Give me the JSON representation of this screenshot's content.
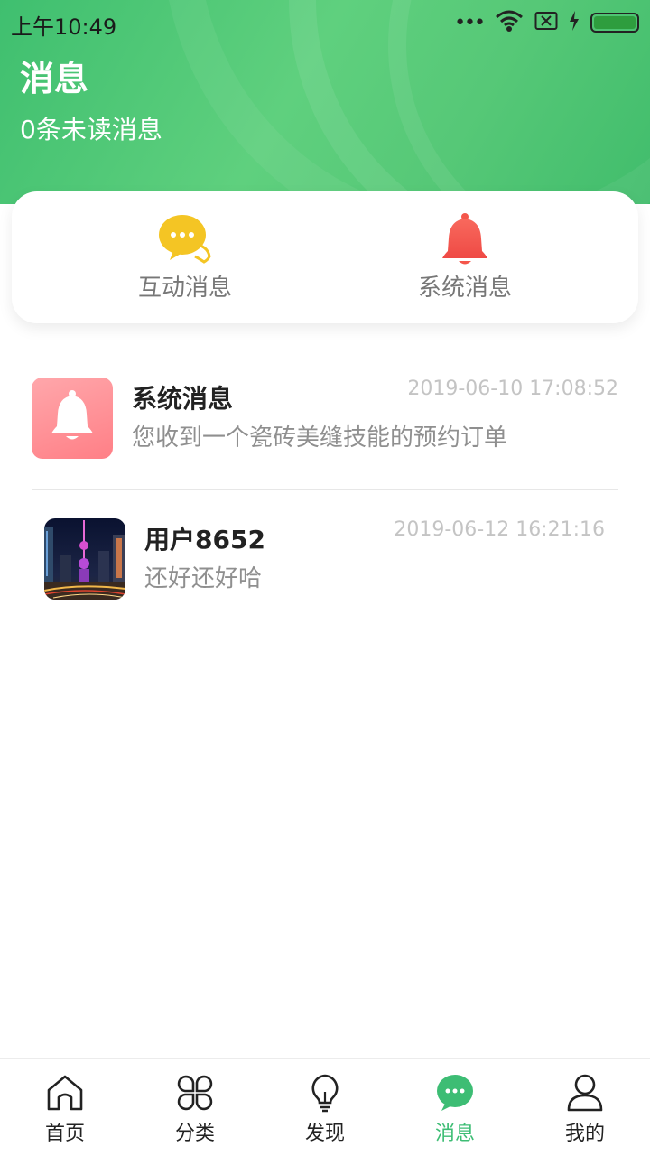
{
  "status_bar": {
    "time": "上午10:49",
    "dots": "•••",
    "icons": [
      "wifi-icon",
      "sim-x-icon",
      "charging-icon",
      "battery-icon"
    ],
    "battery_level": 1.0
  },
  "header": {
    "title": "消息",
    "unread": "0条未读消息"
  },
  "categories": [
    {
      "label": "互动消息",
      "icon": "chat-bubble-icon",
      "color": "#f4c524"
    },
    {
      "label": "系统消息",
      "icon": "bell-icon",
      "color": "#f4564b"
    }
  ],
  "messages": [
    {
      "name": "系统消息",
      "preview": "您收到一个瓷砖美缝技能的预约订单",
      "time": "2019-06-10 17:08:52",
      "avatar": "bell-icon",
      "avatar_color": "#ff8d92"
    },
    {
      "name": "用户8652",
      "preview": "还好还好哈",
      "time": "2019-06-12 16:21:16",
      "avatar": "city-night-photo"
    }
  ],
  "tabs": [
    {
      "label": "首页",
      "icon": "home-icon",
      "active": false
    },
    {
      "label": "分类",
      "icon": "category-icon",
      "active": false
    },
    {
      "label": "发现",
      "icon": "lightbulb-icon",
      "active": false
    },
    {
      "label": "消息",
      "icon": "message-icon",
      "active": true
    },
    {
      "label": "我的",
      "icon": "user-icon",
      "active": false
    }
  ],
  "colors": {
    "header_green": "#4cc573",
    "active_tab": "#3dbd74",
    "muted_text": "#8f8f8f"
  }
}
